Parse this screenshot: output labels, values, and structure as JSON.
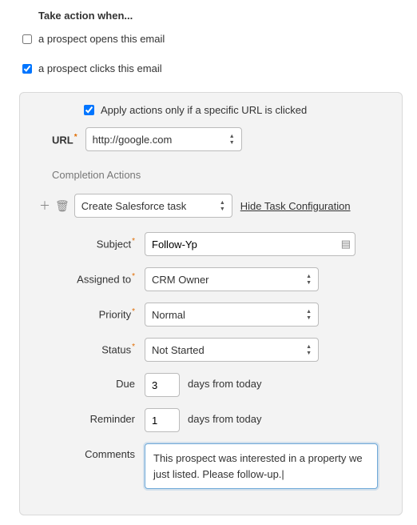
{
  "heading": "Take action when...",
  "triggers": {
    "opens_label": "a prospect opens this email",
    "opens_checked": false,
    "clicks_label": "a prospect clicks this email",
    "clicks_checked": true
  },
  "panel": {
    "apply_label": "Apply actions only if a specific URL is clicked",
    "apply_checked": true,
    "url_label": "URL",
    "url_value": "http://google.com",
    "section_title": "Completion Actions",
    "action_select": "Create Salesforce task",
    "hide_link": "Hide Task Configuration",
    "fields": {
      "subject": {
        "label": "Subject",
        "value": "Follow-Yp"
      },
      "assigned_to": {
        "label": "Assigned to",
        "value": "CRM Owner"
      },
      "priority": {
        "label": "Priority",
        "value": "Normal"
      },
      "status": {
        "label": "Status",
        "value": "Not Started"
      },
      "due": {
        "label": "Due",
        "value": "3",
        "suffix": "days from today"
      },
      "reminder": {
        "label": "Reminder",
        "value": "1",
        "suffix": "days from today"
      },
      "comments": {
        "label": "Comments",
        "value": "This prospect was interested in a property we just listed.  Please follow-up."
      }
    }
  }
}
